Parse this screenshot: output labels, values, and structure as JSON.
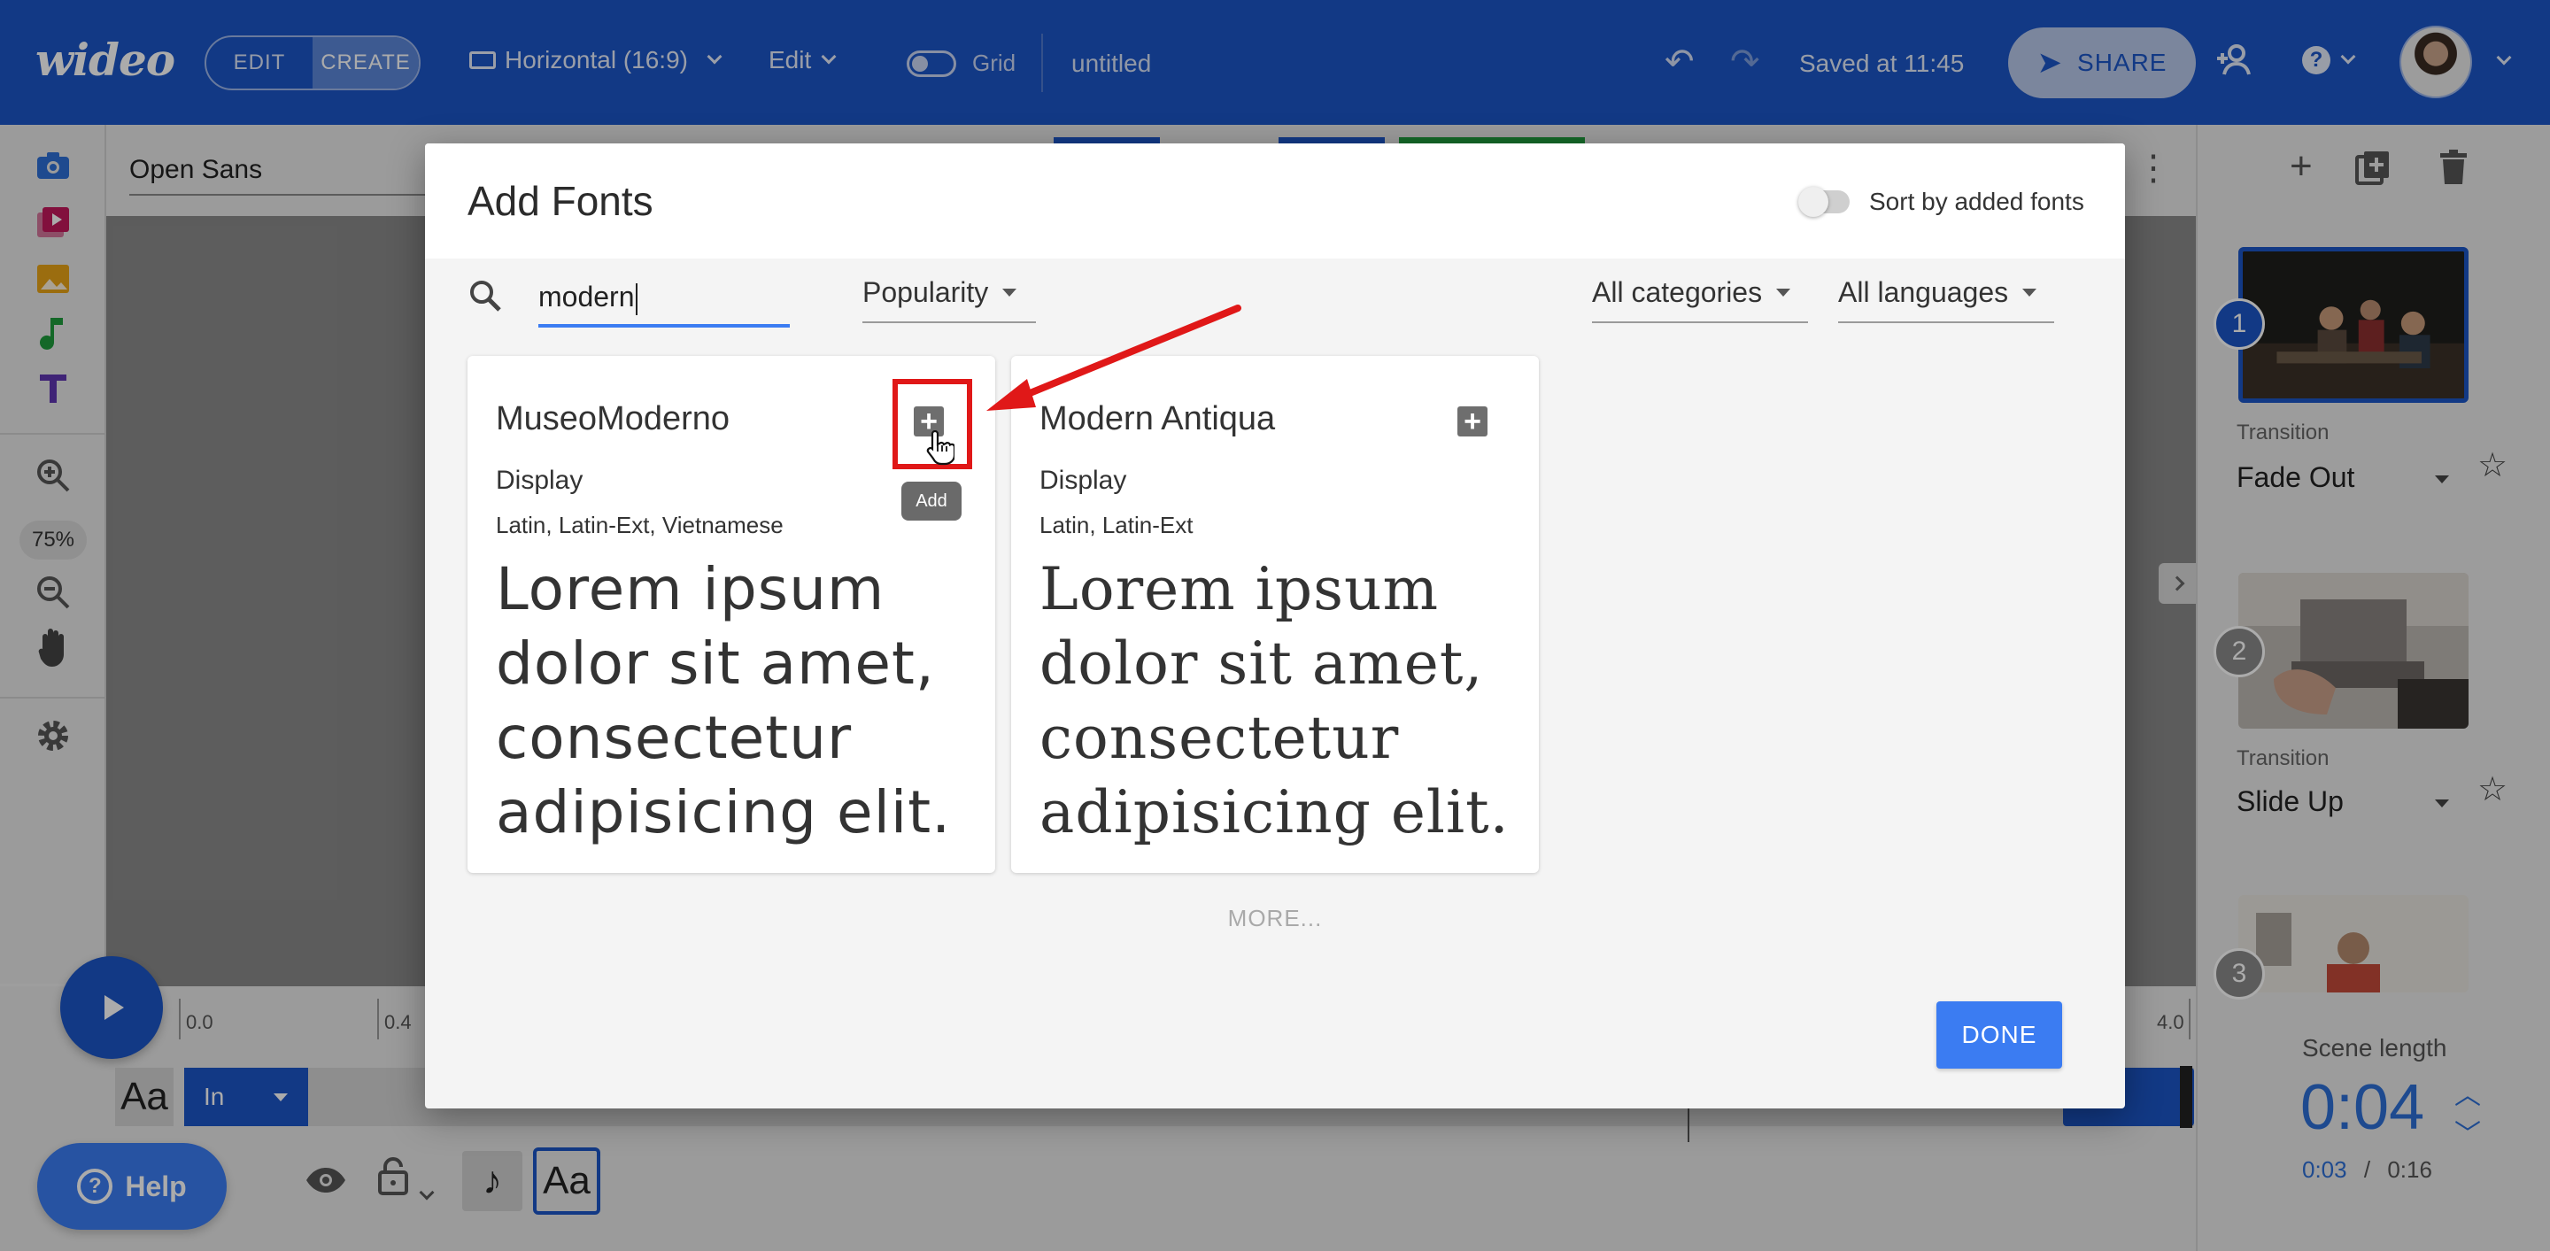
{
  "header": {
    "logo": "wideo",
    "mode_edit": "EDIT",
    "mode_create": "CREATE",
    "aspect": "Horizontal (16:9)",
    "edit_menu": "Edit",
    "grid_label": "Grid",
    "doc_title": "untitled",
    "saved_status": "Saved at 11:45",
    "share_label": "SHARE"
  },
  "left_tools": {
    "zoom_level": "75%"
  },
  "font_bar": {
    "current_font": "Open Sans"
  },
  "scenes": [
    {
      "number": "1",
      "transition_label": "Transition",
      "transition": "Fade Out"
    },
    {
      "number": "2",
      "transition_label": "Transition",
      "transition": "Slide Up"
    },
    {
      "number": "3"
    }
  ],
  "timeline": {
    "ticks": [
      "0.0",
      "0.4",
      "4.0"
    ],
    "track_label": "Aa",
    "track_anim": "In",
    "help_label": "Help",
    "bottom_aa": "Aa",
    "scene_length_label": "Scene length",
    "scene_length": "0:04",
    "current_time": "0:03",
    "separator": "/",
    "total_time": "0:16"
  },
  "modal": {
    "title": "Add Fonts",
    "sort_label": "Sort by added fonts",
    "search_value": "modern",
    "sort_by": "Popularity",
    "category_filter": "All categories",
    "language_filter": "All languages",
    "cards": [
      {
        "name": "MuseoModerno",
        "category": "Display",
        "languages": "Latin, Latin-Ext, Vietnamese",
        "preview": "Lorem ipsum dolor sit amet, consectetur adipisicing elit."
      },
      {
        "name": "Modern Antiqua",
        "category": "Display",
        "languages": "Latin, Latin-Ext",
        "preview": "Lorem ipsum dolor sit amet, consectetur adipisicing elit."
      }
    ],
    "add_tooltip": "Add",
    "more_label": "MORE...",
    "done_label": "DONE"
  },
  "colors": {
    "brand_blue": "#1c55c6",
    "accent_blue": "#3b7cf2",
    "highlight_red": "#e01818"
  }
}
